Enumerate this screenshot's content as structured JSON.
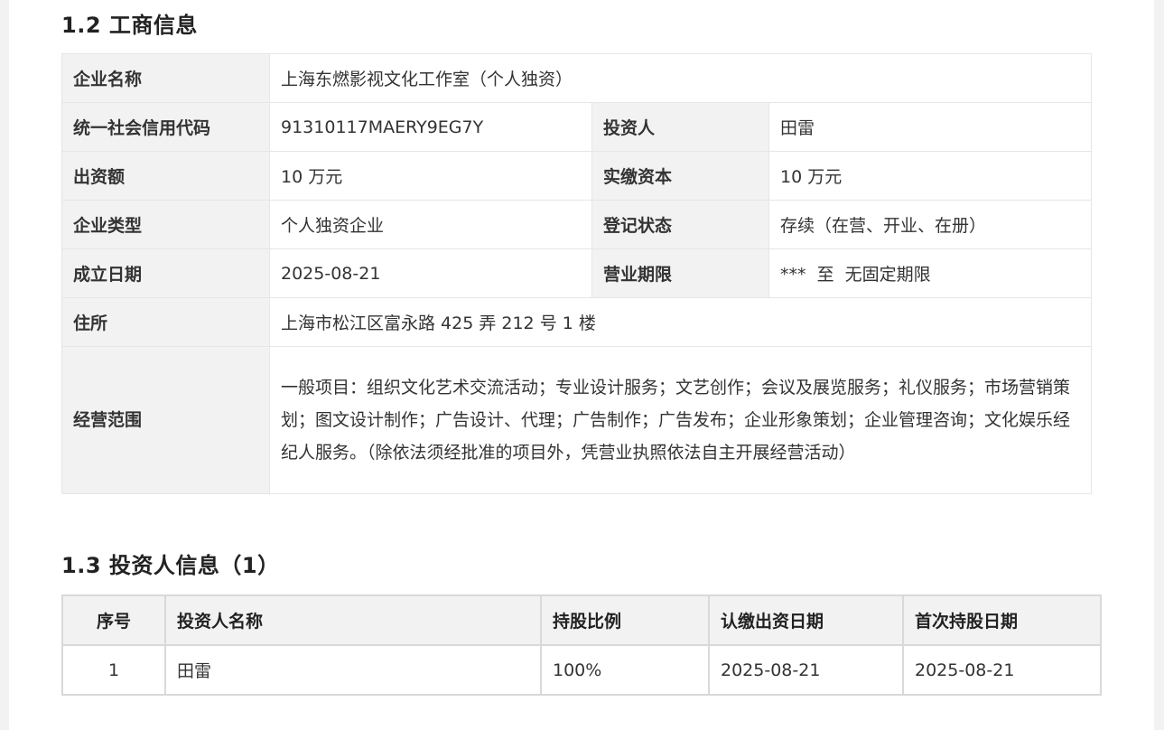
{
  "section_business": {
    "title": "1.2  工商信息",
    "rows": {
      "company_name": {
        "label": "企业名称",
        "value": "上海东燃影视文化工作室（个人独资）"
      },
      "credit_code": {
        "label": "统一社会信用代码",
        "value": "91310117MAERY9EG7Y"
      },
      "investor": {
        "label": "投资人",
        "value": "田雷"
      },
      "capital": {
        "label": "出资额",
        "value": "10 万元"
      },
      "paid_capital": {
        "label": "实缴资本",
        "value": "10 万元"
      },
      "company_type": {
        "label": "企业类型",
        "value": "个人独资企业"
      },
      "reg_status": {
        "label": "登记状态",
        "value": "存续（在营、开业、在册）"
      },
      "found_date": {
        "label": "成立日期",
        "value": "2025-08-21"
      },
      "term": {
        "label": "营业期限",
        "value": "***  至  无固定期限"
      },
      "address": {
        "label": "住所",
        "value": "上海市松江区富永路 425 弄 212 号 1 楼"
      },
      "scope": {
        "label": "经营范围",
        "value": "一般项目：组织文化艺术交流活动；专业设计服务；文艺创作；会议及展览服务；礼仪服务；市场营销策划；图文设计制作；广告设计、代理；广告制作；广告发布；企业形象策划；企业管理咨询；文化娱乐经纪人服务。（除依法须经批准的项目外，凭营业执照依法自主开展经营活动）"
      }
    }
  },
  "section_investor": {
    "title": "1.3  投资人信息（1）",
    "headers": {
      "index": "序号",
      "name": "投资人名称",
      "ratio": "持股比例",
      "subscribe_date": "认缴出资日期",
      "first_hold_date": "首次持股日期"
    },
    "rows": [
      {
        "index": "1",
        "name": "田雷",
        "ratio": "100%",
        "subscribe_date": "2025-08-21",
        "first_hold_date": "2025-08-21"
      }
    ]
  }
}
